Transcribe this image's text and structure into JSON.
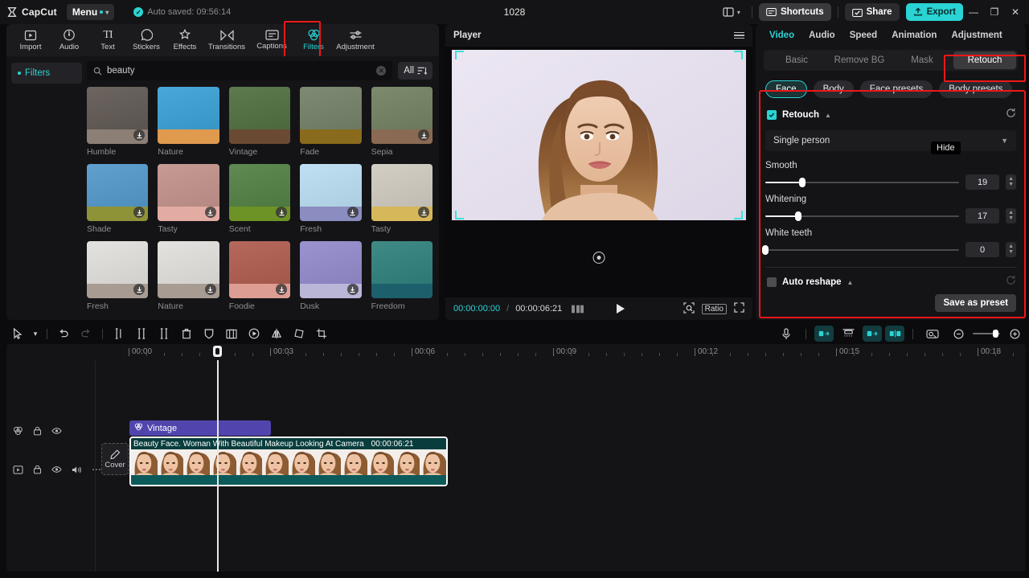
{
  "titlebar": {
    "brand": "CapCut",
    "menu_label": "Menu",
    "autosave": "Auto saved: 09:56:14",
    "project_title": "1028",
    "shortcuts_label": "Shortcuts",
    "share_label": "Share",
    "export_label": "Export",
    "minimize": "—",
    "maximize": "❐",
    "close": "✕",
    "accent": "#2ad4d4"
  },
  "navbar": {
    "items": [
      {
        "label": "Import",
        "icon": "import-icon",
        "active": false
      },
      {
        "label": "Audio",
        "icon": "audio-icon",
        "active": false
      },
      {
        "label": "Text",
        "icon": "text-icon",
        "active": false
      },
      {
        "label": "Stickers",
        "icon": "stickers-icon",
        "active": false
      },
      {
        "label": "Effects",
        "icon": "effects-icon",
        "active": false
      },
      {
        "label": "Transitions",
        "icon": "transitions-icon",
        "active": false
      },
      {
        "label": "Captions",
        "icon": "captions-icon",
        "active": false
      },
      {
        "label": "Filters",
        "icon": "filters-icon",
        "active": true
      },
      {
        "label": "Adjustment",
        "icon": "adjustment-icon",
        "active": false
      }
    ],
    "highlight_color": "#ef1717"
  },
  "library": {
    "category_label": "Filters",
    "search_value": "beauty",
    "search_placeholder": "Search",
    "all_label": "All",
    "filters": [
      {
        "label": "Humble",
        "top": "#6c6560",
        "bot": "#8c7f76",
        "download": true
      },
      {
        "label": "Nature",
        "top": "#4aa8d8",
        "bot": "#e09a4e",
        "download": false
      },
      {
        "label": "Vintage",
        "top": "#5d7a4e",
        "bot": "#6b4a34",
        "download": false
      },
      {
        "label": "Fade",
        "top": "#7e8a74",
        "bot": "#8a6a1c",
        "download": false
      },
      {
        "label": "Sepia",
        "top": "#7d8a6e",
        "bot": "#8a6a52",
        "download": true
      },
      {
        "label": "Shade",
        "top": "#5fa0cf",
        "bot": "#8f9338",
        "download": true
      },
      {
        "label": "Tasty",
        "top": "#c79a93",
        "bot": "#e3aca3",
        "download": true
      },
      {
        "label": "Scent",
        "top": "#5f8a52",
        "bot": "#6d9226",
        "download": true
      },
      {
        "label": "Fresh",
        "top": "#bfe0f2",
        "bot": "#8b8cc0",
        "download": true
      },
      {
        "label": "Tasty",
        "top": "#d3cec4",
        "bot": "#d6b75a",
        "download": true
      },
      {
        "label": "Fresh",
        "top": "#e4e2de",
        "bot": "#a89c92",
        "download": true
      },
      {
        "label": "Nature",
        "top": "#e4e2de",
        "bot": "#a89c92",
        "download": true
      },
      {
        "label": "Foodie",
        "top": "#b5695c",
        "bot": "#dd9d92",
        "download": true
      },
      {
        "label": "Dusk",
        "top": "#9a93cf",
        "bot": "#b9b6d8",
        "download": true
      },
      {
        "label": "Freedom",
        "top": "#3f8a86",
        "bot": "#1d5f6b",
        "download": false
      }
    ]
  },
  "player": {
    "title": "Player",
    "current_time": "00:00:00:00",
    "separator": "/",
    "total_time": "00:00:06:21",
    "ratio_label": "Ratio"
  },
  "inspector": {
    "tabs": [
      {
        "label": "Video",
        "active": true
      },
      {
        "label": "Audio",
        "active": false
      },
      {
        "label": "Speed",
        "active": false
      },
      {
        "label": "Animation",
        "active": false
      },
      {
        "label": "Adjustment",
        "active": false
      }
    ],
    "segments": [
      {
        "label": "Basic",
        "active": false
      },
      {
        "label": "Remove BG",
        "active": false
      },
      {
        "label": "Mask",
        "active": false
      },
      {
        "label": "Retouch",
        "active": true
      }
    ],
    "chips": [
      {
        "label": "Face",
        "active": true
      },
      {
        "label": "Body",
        "active": false
      },
      {
        "label": "Face presets",
        "active": false
      },
      {
        "label": "Body presets",
        "active": false
      }
    ],
    "retouch": {
      "section_label": "Retouch",
      "checked": true,
      "person_mode": "Single person",
      "tooltip": "Hide",
      "sliders": [
        {
          "label": "Smooth",
          "value": 19,
          "percent": 19
        },
        {
          "label": "Whitening",
          "value": 17,
          "percent": 17
        },
        {
          "label": "White teeth",
          "value": 0,
          "percent": 0
        }
      ]
    },
    "auto_reshape": {
      "label": "Auto reshape",
      "checked": false
    },
    "save_preset_label": "Save as preset",
    "highlight_color": "#ef1717"
  },
  "timeline": {
    "ruler_labels": [
      "00:00",
      "00:03",
      "00:06",
      "00:09",
      "00:12",
      "00:15",
      "00:18"
    ],
    "filter_clip": {
      "label": "Vintage",
      "icon": "filters-icon"
    },
    "cover_label": "Cover",
    "video_clip": {
      "name": "Beauty Face. Woman With Beautiful Makeup Looking At Camera",
      "duration": "00:00:06:21"
    },
    "track_head_icons_filter": [
      "filters-icon",
      "lock-icon",
      "eye-icon"
    ],
    "track_head_icons_video": [
      "video-icon",
      "lock-icon",
      "eye-icon",
      "volume-icon",
      "more-icon"
    ]
  }
}
